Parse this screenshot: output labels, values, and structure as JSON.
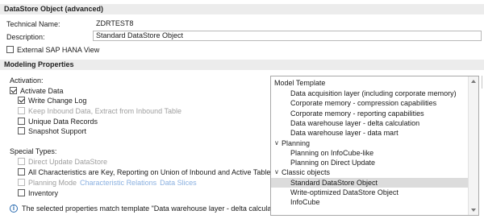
{
  "object_section": {
    "title": "DataStore Object (advanced)",
    "technical_name_label": "Technical Name:",
    "technical_name_value": "ZDRTEST8",
    "description_label": "Description:",
    "description_value": "Standard DataStore Object",
    "external_hana_label": "External SAP HANA View",
    "external_hana_checked": false
  },
  "modeling": {
    "title": "Modeling Properties",
    "activation_label": "Activation:",
    "activate_data": {
      "label": "Activate Data",
      "checked": true
    },
    "write_change_log": {
      "label": "Write Change Log",
      "checked": true
    },
    "keep_inbound": {
      "label": "Keep Inbound Data, Extract from Inbound Table",
      "checked": false,
      "disabled": true
    },
    "unique_records": {
      "label": "Unique Data Records",
      "checked": false
    },
    "snapshot_support": {
      "label": "Snapshot Support",
      "checked": false
    },
    "special_types_label": "Special Types:",
    "direct_update": {
      "label": "Direct Update DataStore",
      "checked": false,
      "disabled": true
    },
    "all_characteristics": {
      "label": "All Characteristics are Key, Reporting on Union of Inbound and Active Table",
      "checked": false
    },
    "planning_mode": {
      "label": "Planning Mode",
      "checked": false,
      "disabled": true
    },
    "characteristic_relations_link": "Characteristic Relations",
    "data_slices_link": "Data Slices",
    "inventory": {
      "label": "Inventory",
      "checked": false
    },
    "info_message": "The selected properties match template \"Data warehouse layer - delta calculation\"."
  },
  "template_tree": {
    "header": "Model Template",
    "items": [
      {
        "label": "Data acquisition layer (including corporate memory)",
        "level": 1,
        "expander": ""
      },
      {
        "label": "Corporate memory - compression capabilities",
        "level": 1,
        "expander": ""
      },
      {
        "label": "Corporate memory - reporting capabilities",
        "level": 1,
        "expander": ""
      },
      {
        "label": "Data warehouse layer - delta calculation",
        "level": 1,
        "expander": ""
      },
      {
        "label": "Data warehouse layer - data mart",
        "level": 1,
        "expander": ""
      },
      {
        "label": "Planning",
        "level": 0,
        "expander": "∨"
      },
      {
        "label": "Planning on InfoCube-like",
        "level": 1,
        "expander": ""
      },
      {
        "label": "Planning on Direct Update",
        "level": 1,
        "expander": ""
      },
      {
        "label": "Classic objects",
        "level": 0,
        "expander": "∨"
      },
      {
        "label": "Standard DataStore Object",
        "level": 1,
        "expander": "",
        "selected": true
      },
      {
        "label": "Write-optimized DataStore Object",
        "level": 1,
        "expander": ""
      },
      {
        "label": "InfoCube",
        "level": 1,
        "expander": ""
      }
    ]
  },
  "colors": {
    "section_header_bg": "#ececec",
    "selected_row_bg": "#dcdcdc",
    "link": "#8ab0e0",
    "info_icon": "#2b6cb0"
  }
}
